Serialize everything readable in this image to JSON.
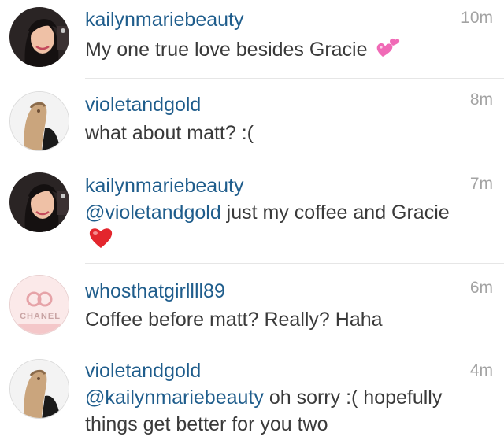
{
  "comments": [
    {
      "username": "kailynmariebeauty",
      "time": "10m",
      "text": "My one true love besides Gracie",
      "emoji": "two-hearts-icon"
    },
    {
      "username": "violetandgold",
      "time": "8m",
      "text": "what about matt? :("
    },
    {
      "username": "kailynmariebeauty",
      "time": "7m",
      "mention": "@violetandgold",
      "text": " just my coffee and Gracie",
      "emoji": "red-heart-icon"
    },
    {
      "username": "whosthatgirllll89",
      "time": "6m",
      "text": "Coffee before matt? Really? Haha",
      "avatar_label": "CHANEL"
    },
    {
      "username": "violetandgold",
      "time": "4m",
      "mention": "@kailynmariebeauty",
      "text": " oh sorry :( hopefully things get better for you two"
    }
  ],
  "colors": {
    "username": "#1f5d8c",
    "timestamp": "#a3a3a3",
    "body_text": "#3a3a3a",
    "divider": "#e6e6e6",
    "heart_red": "#e3262d",
    "heart_pink": "#f06ab6"
  }
}
